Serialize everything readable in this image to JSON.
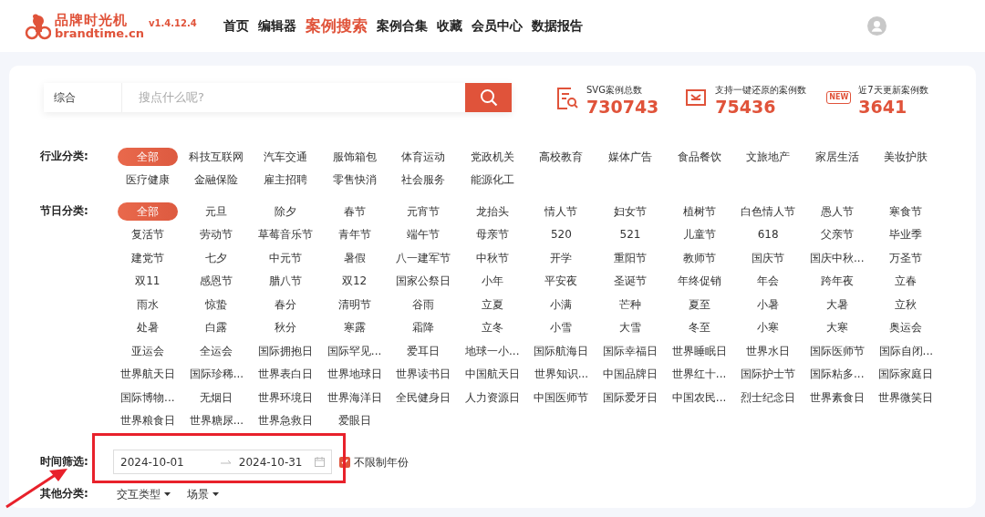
{
  "header": {
    "logo_title": "品牌时光机",
    "logo_domain": "brandtime.cn",
    "version": "v1.4.12.4",
    "nav": [
      {
        "label": "首页",
        "selected": false
      },
      {
        "label": "编辑器",
        "selected": false
      },
      {
        "label": "案例搜索",
        "selected": true
      },
      {
        "label": "案例合集",
        "selected": false
      },
      {
        "label": "收藏",
        "selected": false
      },
      {
        "label": "会员中心",
        "selected": false
      },
      {
        "label": "数据报告",
        "selected": false
      }
    ]
  },
  "search": {
    "scope": "综合",
    "placeholder": "搜点什么呢?"
  },
  "stats": [
    {
      "kind": "doc",
      "label": "SVG案例总数",
      "value": "730743"
    },
    {
      "kind": "restore",
      "label": "支持一键还原的案例数",
      "value": "75436"
    },
    {
      "kind": "new",
      "badge": "NEW",
      "label": "近7天更新案例数",
      "value": "3641"
    }
  ],
  "filters": [
    {
      "label": "行业分类:",
      "items": [
        {
          "label": "全部",
          "selected": true
        },
        {
          "label": "科技互联网",
          "selected": false
        },
        {
          "label": "汽车交通",
          "selected": false
        },
        {
          "label": "服饰箱包",
          "selected": false
        },
        {
          "label": "体育运动",
          "selected": false
        },
        {
          "label": "党政机关",
          "selected": false
        },
        {
          "label": "高校教育",
          "selected": false
        },
        {
          "label": "媒体广告",
          "selected": false
        },
        {
          "label": "食品餐饮",
          "selected": false
        },
        {
          "label": "文旅地产",
          "selected": false
        },
        {
          "label": "家居生活",
          "selected": false
        },
        {
          "label": "美妆护肤",
          "selected": false
        },
        {
          "label": "医疗健康",
          "selected": false
        },
        {
          "label": "金融保险",
          "selected": false
        },
        {
          "label": "雇主招聘",
          "selected": false
        },
        {
          "label": "零售快消",
          "selected": false
        },
        {
          "label": "社会服务",
          "selected": false
        },
        {
          "label": "能源化工",
          "selected": false
        }
      ]
    },
    {
      "label": "节日分类:",
      "items": [
        {
          "label": "全部",
          "selected": true
        },
        {
          "label": "元旦",
          "selected": false
        },
        {
          "label": "除夕",
          "selected": false
        },
        {
          "label": "春节",
          "selected": false
        },
        {
          "label": "元宵节",
          "selected": false
        },
        {
          "label": "龙抬头",
          "selected": false
        },
        {
          "label": "情人节",
          "selected": false
        },
        {
          "label": "妇女节",
          "selected": false
        },
        {
          "label": "植树节",
          "selected": false
        },
        {
          "label": "白色情人节",
          "selected": false
        },
        {
          "label": "愚人节",
          "selected": false
        },
        {
          "label": "寒食节",
          "selected": false
        },
        {
          "label": "复活节",
          "selected": false
        },
        {
          "label": "劳动节",
          "selected": false
        },
        {
          "label": "草莓音乐节",
          "selected": false
        },
        {
          "label": "青年节",
          "selected": false
        },
        {
          "label": "端午节",
          "selected": false
        },
        {
          "label": "母亲节",
          "selected": false
        },
        {
          "label": "520",
          "selected": false
        },
        {
          "label": "521",
          "selected": false
        },
        {
          "label": "儿童节",
          "selected": false
        },
        {
          "label": "618",
          "selected": false
        },
        {
          "label": "父亲节",
          "selected": false
        },
        {
          "label": "毕业季",
          "selected": false
        },
        {
          "label": "建党节",
          "selected": false
        },
        {
          "label": "七夕",
          "selected": false
        },
        {
          "label": "中元节",
          "selected": false
        },
        {
          "label": "暑假",
          "selected": false
        },
        {
          "label": "八一建军节",
          "selected": false
        },
        {
          "label": "中秋节",
          "selected": false
        },
        {
          "label": "开学",
          "selected": false
        },
        {
          "label": "重阳节",
          "selected": false
        },
        {
          "label": "教师节",
          "selected": false
        },
        {
          "label": "国庆节",
          "selected": false
        },
        {
          "label": "国庆中秋...",
          "selected": false
        },
        {
          "label": "万圣节",
          "selected": false
        },
        {
          "label": "双11",
          "selected": false
        },
        {
          "label": "感恩节",
          "selected": false
        },
        {
          "label": "腊八节",
          "selected": false
        },
        {
          "label": "双12",
          "selected": false
        },
        {
          "label": "国家公祭日",
          "selected": false
        },
        {
          "label": "小年",
          "selected": false
        },
        {
          "label": "平安夜",
          "selected": false
        },
        {
          "label": "圣诞节",
          "selected": false
        },
        {
          "label": "年终促销",
          "selected": false
        },
        {
          "label": "年会",
          "selected": false
        },
        {
          "label": "跨年夜",
          "selected": false
        },
        {
          "label": "立春",
          "selected": false
        },
        {
          "label": "雨水",
          "selected": false
        },
        {
          "label": "惊蛰",
          "selected": false
        },
        {
          "label": "春分",
          "selected": false
        },
        {
          "label": "清明节",
          "selected": false
        },
        {
          "label": "谷雨",
          "selected": false
        },
        {
          "label": "立夏",
          "selected": false
        },
        {
          "label": "小满",
          "selected": false
        },
        {
          "label": "芒种",
          "selected": false
        },
        {
          "label": "夏至",
          "selected": false
        },
        {
          "label": "小暑",
          "selected": false
        },
        {
          "label": "大暑",
          "selected": false
        },
        {
          "label": "立秋",
          "selected": false
        },
        {
          "label": "处暑",
          "selected": false
        },
        {
          "label": "白露",
          "selected": false
        },
        {
          "label": "秋分",
          "selected": false
        },
        {
          "label": "寒露",
          "selected": false
        },
        {
          "label": "霜降",
          "selected": false
        },
        {
          "label": "立冬",
          "selected": false
        },
        {
          "label": "小雪",
          "selected": false
        },
        {
          "label": "大雪",
          "selected": false
        },
        {
          "label": "冬至",
          "selected": false
        },
        {
          "label": "小寒",
          "selected": false
        },
        {
          "label": "大寒",
          "selected": false
        },
        {
          "label": "奥运会",
          "selected": false
        },
        {
          "label": "亚运会",
          "selected": false
        },
        {
          "label": "全运会",
          "selected": false
        },
        {
          "label": "国际拥抱日",
          "selected": false
        },
        {
          "label": "国际罕见...",
          "selected": false
        },
        {
          "label": "爱耳日",
          "selected": false
        },
        {
          "label": "地球一小...",
          "selected": false
        },
        {
          "label": "国际航海日",
          "selected": false
        },
        {
          "label": "国际幸福日",
          "selected": false
        },
        {
          "label": "世界睡眠日",
          "selected": false
        },
        {
          "label": "世界水日",
          "selected": false
        },
        {
          "label": "国际医师节",
          "selected": false
        },
        {
          "label": "国际自闭...",
          "selected": false
        },
        {
          "label": "世界航天日",
          "selected": false
        },
        {
          "label": "国际珍稀...",
          "selected": false
        },
        {
          "label": "世界表白日",
          "selected": false
        },
        {
          "label": "世界地球日",
          "selected": false
        },
        {
          "label": "世界读书日",
          "selected": false
        },
        {
          "label": "中国航天日",
          "selected": false
        },
        {
          "label": "世界知识...",
          "selected": false
        },
        {
          "label": "中国品牌日",
          "selected": false
        },
        {
          "label": "世界红十...",
          "selected": false
        },
        {
          "label": "国际护士节",
          "selected": false
        },
        {
          "label": "国际粘多...",
          "selected": false
        },
        {
          "label": "国际家庭日",
          "selected": false
        },
        {
          "label": "国际博物...",
          "selected": false
        },
        {
          "label": "无烟日",
          "selected": false
        },
        {
          "label": "世界环境日",
          "selected": false
        },
        {
          "label": "世界海洋日",
          "selected": false
        },
        {
          "label": "全民健身日",
          "selected": false
        },
        {
          "label": "人力资源日",
          "selected": false
        },
        {
          "label": "中国医师节",
          "selected": false
        },
        {
          "label": "国际爱牙日",
          "selected": false
        },
        {
          "label": "中国农民...",
          "selected": false
        },
        {
          "label": "烈士纪念日",
          "selected": false
        },
        {
          "label": "世界素食日",
          "selected": false
        },
        {
          "label": "世界微笑日",
          "selected": false
        },
        {
          "label": "世界粮食日",
          "selected": false
        },
        {
          "label": "世界糖尿...",
          "selected": false
        },
        {
          "label": "世界急救日",
          "selected": false
        },
        {
          "label": "爱眼日",
          "selected": false
        }
      ]
    }
  ],
  "time_filter": {
    "label": "时间筛选:",
    "start": "2024-10-01",
    "end": "2024-10-31",
    "unlimited_year": {
      "label": "不限制年份",
      "checked": true
    },
    "highlight": {
      "color": "#e8212b"
    }
  },
  "other": {
    "label": "其他分类:",
    "dropdowns": [
      "交互类型",
      "场景"
    ]
  }
}
